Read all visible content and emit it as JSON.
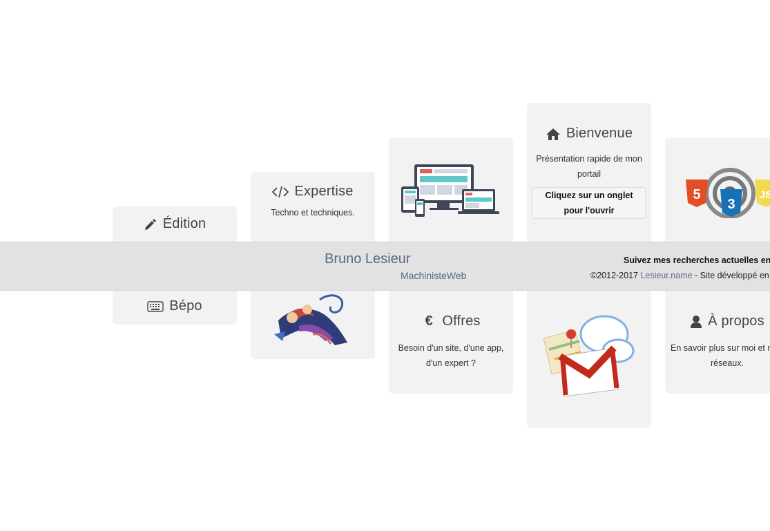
{
  "cards": {
    "edition": {
      "title": "Édition"
    },
    "expertise": {
      "title": "Expertise",
      "desc": "Techno et techniques."
    },
    "bienvenue": {
      "title": "Bienvenue",
      "desc": "Présentation rapide de mon portail",
      "cta": "Cliquez sur un onglet pour l'ouvrir"
    },
    "bepo": {
      "title": "Bépo"
    },
    "offres": {
      "title": "Offres",
      "desc": "Besoin d'un site, d'une app, d'un expert ?"
    },
    "apropos": {
      "title": "À propos",
      "desc": "En savoir plus sur moi et mes réseaux."
    }
  },
  "footer": {
    "name": "Bruno Lesieur",
    "subtitle": "MachinisteWeb",
    "follow": "Suivez mes recherches actuelles en",
    "copyright_prefix": "©2012-2017 ",
    "link": "Lesieur.name",
    "copyright_suffix": " - Site développé en",
    "link_color": "#5a6a84"
  },
  "icons": {
    "edition": "pencil-icon",
    "expertise": "code-icon",
    "bienvenue": "home-icon",
    "bepo": "keyboard-icon",
    "offres": "euro-icon",
    "apropos": "user-icon"
  }
}
